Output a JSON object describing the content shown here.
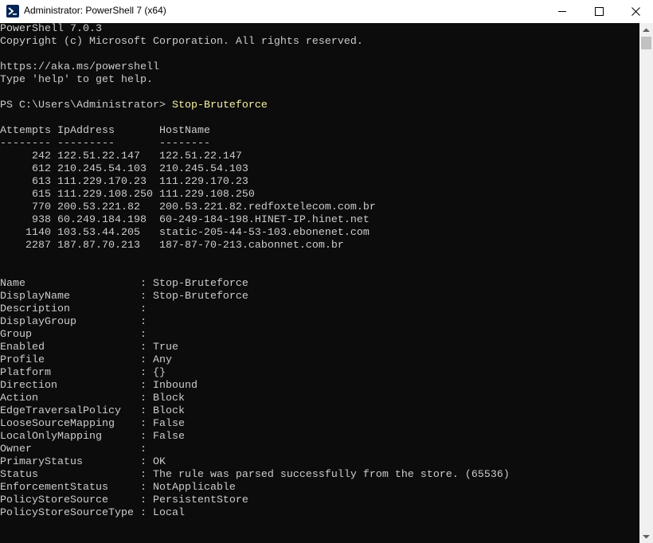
{
  "window": {
    "title": "Administrator: PowerShell 7 (x64)"
  },
  "console": {
    "header": [
      "PowerShell 7.0.3",
      "Copyright (c) Microsoft Corporation. All rights reserved.",
      "",
      "https://aka.ms/powershell",
      "Type 'help' to get help."
    ],
    "prompt": "PS C:\\Users\\Administrator> ",
    "command": "Stop-Bruteforce",
    "table_header": "Attempts IpAddress       HostName",
    "table_rule": "-------- ---------       --------",
    "table_rows": [
      "     242 122.51.22.147   122.51.22.147",
      "     612 210.245.54.103  210.245.54.103",
      "     613 111.229.170.23  111.229.170.23",
      "     615 111.229.108.250 111.229.108.250",
      "     770 200.53.221.82   200.53.221.82.redfoxtelecom.com.br",
      "     938 60.249.184.198  60-249-184-198.HINET-IP.hinet.net",
      "    1140 103.53.44.205   static-205-44-53-103.ebonenet.com",
      "    2287 187.87.70.213   187-87-70-213.cabonnet.com.br"
    ],
    "rule_properties": [
      "Name                  : Stop-Bruteforce",
      "DisplayName           : Stop-Bruteforce",
      "Description           :",
      "DisplayGroup          :",
      "Group                 :",
      "Enabled               : True",
      "Profile               : Any",
      "Platform              : {}",
      "Direction             : Inbound",
      "Action                : Block",
      "EdgeTraversalPolicy   : Block",
      "LooseSourceMapping    : False",
      "LocalOnlyMapping      : False",
      "Owner                 :",
      "PrimaryStatus         : OK",
      "Status                : The rule was parsed successfully from the store. (65536)",
      "EnforcementStatus     : NotApplicable",
      "PolicyStoreSource     : PersistentStore",
      "PolicyStoreSourceType : Local"
    ]
  },
  "colors": {
    "console_bg": "#0c0c0c",
    "console_fg": "#cccccc",
    "command_fg": "#f9f1a5",
    "icon_bg": "#012456"
  },
  "icons": {
    "app": "powershell-icon",
    "minimize": "minimize-icon",
    "maximize": "maximize-icon",
    "close": "close-icon"
  }
}
